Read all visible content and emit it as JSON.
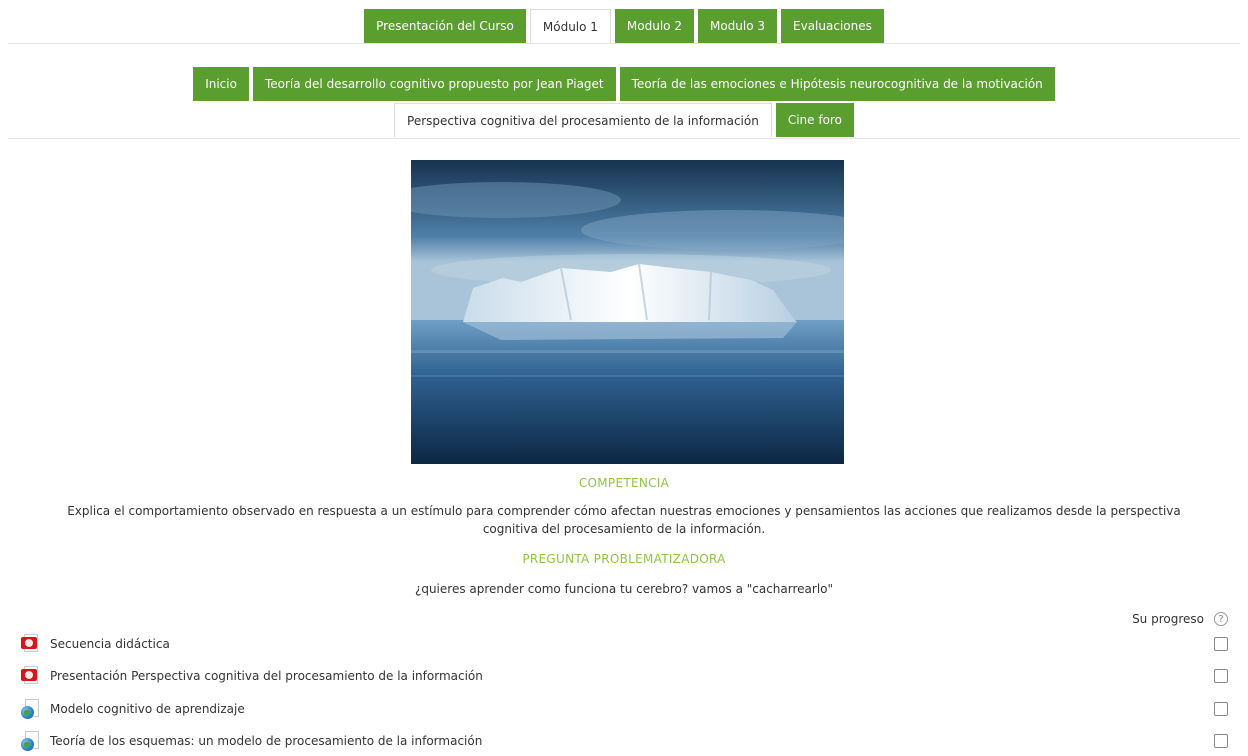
{
  "top_tabs": [
    {
      "label": "Presentación del Curso",
      "active": false
    },
    {
      "label": "Módulo 1",
      "active": true
    },
    {
      "label": "Modulo 2",
      "active": false
    },
    {
      "label": "Modulo 3",
      "active": false
    },
    {
      "label": "Evaluaciones",
      "active": false
    }
  ],
  "sub_tabs_row1": [
    {
      "label": "Inicio",
      "active": false
    },
    {
      "label": "Teoría del desarrollo cognitivo propuesto por Jean Piaget",
      "active": false
    },
    {
      "label": "Teoría de las emociones e Hipótesis neurocognitiva de la motivación",
      "active": false
    }
  ],
  "sub_tabs_row2": [
    {
      "label": "Perspectiva cognitiva del procesamiento de la información",
      "active": true
    },
    {
      "label": "Cine foro",
      "active": false
    }
  ],
  "content": {
    "competencia_heading": "COMPETENCIA",
    "competencia_text_line1": "Explica el comportamiento observado en respuesta a un estímulo para comprender cómo afectan nuestras emociones y pensamientos las acciones que realizamos desde la perspectiva",
    "competencia_text_line2": "cognitiva del procesamiento de la información.",
    "pregunta_heading": "PREGUNTA PROBLEMATIZADORA",
    "pregunta_text": "¿quieres aprender como funciona tu cerebro? vamos a \"cacharrearlo\""
  },
  "progress": {
    "label": "Su progreso",
    "help_icon": "?"
  },
  "activities": [
    {
      "icon": "pdf-icon",
      "label": "Secuencia didáctica",
      "completed": false
    },
    {
      "icon": "pdf-icon",
      "label": "Presentación Perspectiva cognitiva del procesamiento de la información",
      "completed": false
    },
    {
      "icon": "url-icon",
      "label": "Modelo cognitivo de aprendizaje",
      "completed": false
    },
    {
      "icon": "url-icon",
      "label": "Teoría de los esquemas: un modelo de procesamiento de la información",
      "completed": false
    }
  ],
  "colors": {
    "tab_green": "#5a9e2f",
    "heading_green": "#8dc63f"
  }
}
